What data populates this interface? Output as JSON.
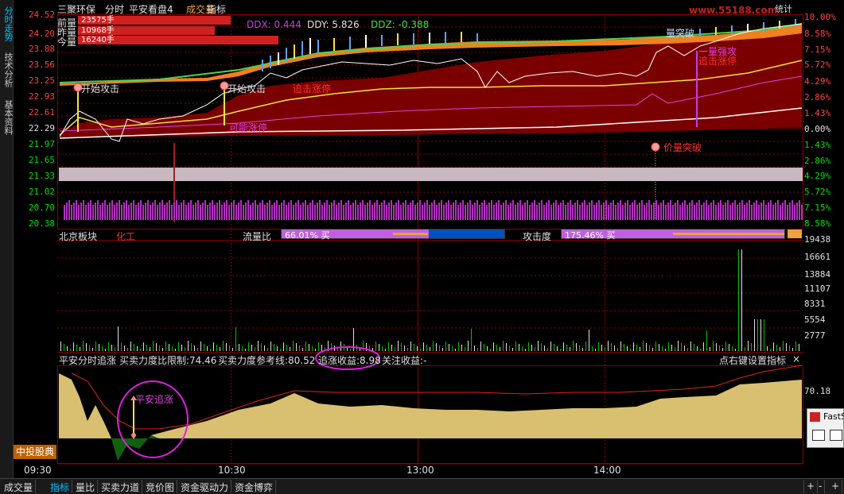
{
  "window": {
    "title": "分时 平安看盘4 成交量 指标"
  },
  "stock": {
    "name": "三聚环保",
    "mode": "分时",
    "tools": [
      "平安看盘4",
      "成交量",
      "指标"
    ]
  },
  "stats_button": "统计",
  "sidebar_tabs": [
    "分时走势",
    "技术分析",
    "基本资料"
  ],
  "price_axis_left": [
    "24.52",
    "24.20",
    "23.88",
    "23.56",
    "23.25",
    "22.93",
    "22.61",
    "22.29",
    "21.97",
    "21.65",
    "21.33",
    "21.02",
    "20.70",
    "20.38"
  ],
  "price_axis_right": [
    "10.00%",
    "8.58%",
    "7.15%",
    "5.72%",
    "4.29%",
    "2.86%",
    "1.43%",
    "0.00%",
    "1.43%",
    "2.86%",
    "4.29%",
    "5.72%",
    "7.15%",
    "8.58%"
  ],
  "volume_rows": [
    {
      "label": "前量",
      "value": "23575手"
    },
    {
      "label": "昨量",
      "value": "10968手"
    },
    {
      "label": "今量",
      "value": "16240手"
    }
  ],
  "ddx": {
    "ddx": "DDX: 0.444",
    "ddy": "DDY: 5.826",
    "ddz": "DDZ: -0.388"
  },
  "annotations": {
    "start_attack_1": "开始攻击",
    "start_attack_2": "开始攻击",
    "chase_limit": "追击涨停",
    "possible_limit": "可能涨停",
    "volume_break": "量突破",
    "top_a": "一量强攻",
    "top_b": "追击涨停",
    "price_volume_break": "价量突破"
  },
  "board": {
    "label": "北京板块",
    "sector": "化工",
    "flow_label": "流量比",
    "flow_value": "66.01% 买",
    "attack_label": "攻击度",
    "attack_value": "175.46% 买"
  },
  "volume_axis": [
    "19438",
    "16661",
    "13884",
    "11107",
    "8331",
    "5554",
    "2777"
  ],
  "indicator": {
    "name": "平安分时追涨",
    "limit": "买卖力度比限制:74.46",
    "ref": "买卖力度参考线:80.52",
    "gain": "追涨收益:8.98",
    "focus": "关注收益:-",
    "settings": "点右键设置指标",
    "close": "×",
    "axis_value": "70.18",
    "marker": "平安追涨"
  },
  "time_axis": [
    "09:30",
    "10:30",
    "13:00",
    "14:00"
  ],
  "brand_button": "中投股典",
  "fast_label": "FastS",
  "watermark": "www.55188.com",
  "bottom_tabs": [
    "成交量",
    "指标",
    "量比",
    "买卖力道",
    "竞价图",
    "资金驱动力",
    "资金博弈"
  ],
  "bottom_right": [
    "+",
    "-",
    "+"
  ],
  "colors": {
    "red": "#ff4040",
    "green": "#00e000",
    "magenta": "#c040c0",
    "gold": "#e8d070",
    "darkred": "#7a0000"
  }
}
